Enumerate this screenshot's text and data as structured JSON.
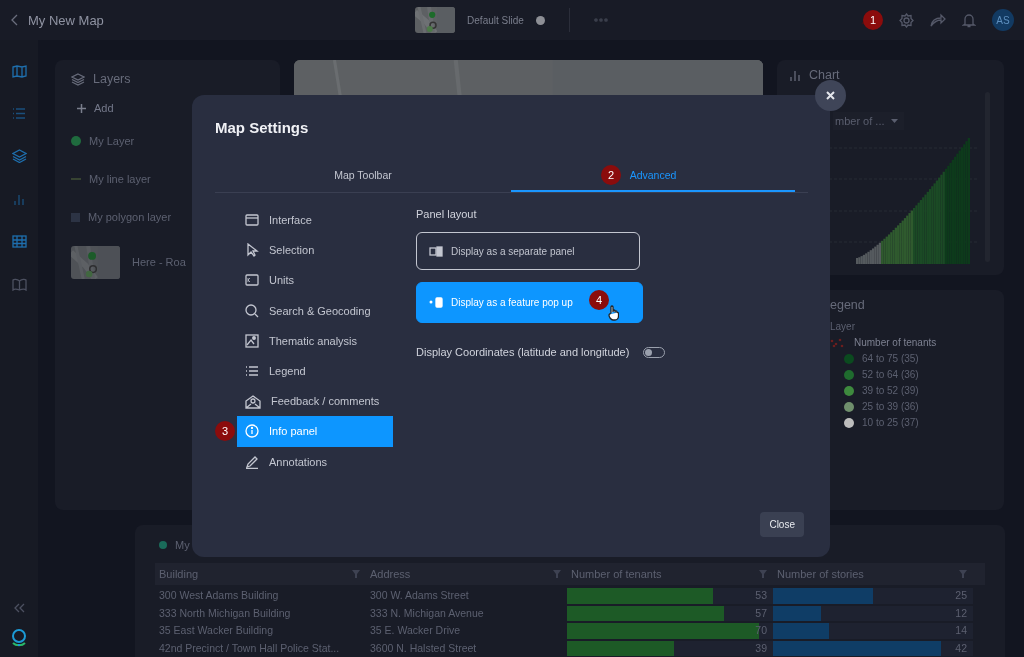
{
  "topbar": {
    "title": "My New Map",
    "slide_name": "Default Slide",
    "step_badge": "1",
    "avatar": "AS"
  },
  "layers_panel": {
    "title": "Layers",
    "add": "Add",
    "items": [
      {
        "name": "My Layer",
        "kind": "point"
      },
      {
        "name": "My line layer",
        "kind": "line"
      },
      {
        "name": "My polygon layer",
        "kind": "polygon"
      },
      {
        "name": "Here - Roa",
        "kind": "basemap"
      }
    ]
  },
  "chart_panel": {
    "title": "Chart",
    "dropdown": "mber of ..."
  },
  "legend_panel": {
    "title": "egend",
    "layer": "Layer",
    "field": "Number of tenants",
    "classes": [
      {
        "label": "64 to 75 (35)",
        "color": "#0b4a1f"
      },
      {
        "label": "52 to 64 (36)",
        "color": "#1f6b2e"
      },
      {
        "label": "39 to 52 (39)",
        "color": "#3e8a3e"
      },
      {
        "label": "25 to 39 (36)",
        "color": "#6f8f6c"
      },
      {
        "label": "10 to 25 (37)",
        "color": "#bdbdbd"
      }
    ]
  },
  "table": {
    "title": "My",
    "columns": [
      "Building",
      "Address",
      "Number of tenants",
      "Number of stories"
    ],
    "rows": [
      {
        "building": "300 West Adams Building",
        "address": "300 W. Adams Street",
        "tenants": {
          "value": "53",
          "level": 0.71
        },
        "stories": {
          "value": "25",
          "level": 0.5
        }
      },
      {
        "building": "333 North Michigan Building",
        "address": "333 N. Michigan Avenue",
        "tenants": {
          "value": "57",
          "level": 0.76
        },
        "stories": {
          "value": "12",
          "level": 0.24
        }
      },
      {
        "building": "35 East Wacker Building",
        "address": "35 E. Wacker Drive",
        "tenants": {
          "value": "70",
          "level": 0.93
        },
        "stories": {
          "value": "14",
          "level": 0.28
        }
      },
      {
        "building": "42nd Precinct / Town Hall Police Stat...",
        "address": "3600 N. Halsted Street",
        "tenants": {
          "value": "39",
          "level": 0.52
        },
        "stories": {
          "value": "42",
          "level": 0.84
        }
      }
    ]
  },
  "dialog": {
    "title": "Map Settings",
    "tabs": [
      {
        "label": "Map Toolbar",
        "selected": false
      },
      {
        "label": "Advanced",
        "selected": true,
        "step_badge": "2"
      }
    ],
    "menu": [
      {
        "label": "Interface",
        "selected": false
      },
      {
        "label": "Selection",
        "selected": false
      },
      {
        "label": "Units",
        "selected": false
      },
      {
        "label": "Search & Geocoding",
        "selected": false
      },
      {
        "label": "Thematic analysis",
        "selected": false
      },
      {
        "label": "Legend",
        "selected": false
      },
      {
        "label": "Feedback / comments",
        "selected": false
      },
      {
        "label": "Info panel",
        "selected": true,
        "step_badge": "3"
      },
      {
        "label": "Annotations",
        "selected": false
      }
    ],
    "section_title": "Panel layout",
    "layout_options": [
      {
        "label": "Display as a separate panel",
        "selected": false
      },
      {
        "label": "Display as a feature pop up",
        "selected": true,
        "step_badge": "4"
      }
    ],
    "coordinates_toggle": {
      "label": "Display Coordinates (latitude and longitude)",
      "on": false
    },
    "close_button": "Close"
  }
}
